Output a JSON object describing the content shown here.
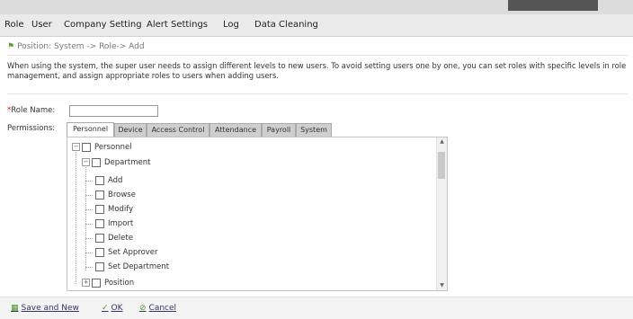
{
  "nav": {
    "items": [
      "Role",
      "User",
      "Company Setting",
      "Alert Settings",
      "Log",
      "Data Cleaning"
    ]
  },
  "breadcrumb": "Position: System -> Role-> Add",
  "description": "When using the system, the super user needs to assign different levels to new users. To avoid setting users one by one, you can set roles with specific levels in role management, and assign appropriate roles to users when adding users.",
  "form": {
    "required_mark": "*",
    "role_name_label": "Role Name:",
    "role_name_value": "",
    "permissions_label": "Permissions:"
  },
  "tabs": [
    "Personnel",
    "Device",
    "Access Control",
    "Attendance",
    "Payroll",
    "System"
  ],
  "active_tab": "Personnel",
  "tree": {
    "root": "Personnel",
    "department": "Department",
    "department_children": [
      "Add",
      "Browse",
      "Modify",
      "Import",
      "Delete",
      "Set Approver",
      "Set Department"
    ],
    "position": "Position"
  },
  "footer": {
    "save_new": "Save and New",
    "ok": "OK",
    "cancel": "Cancel"
  },
  "colors": {
    "nav_bg": "#ebebeb",
    "flag": "#5a9e2f",
    "ok_icon": "#4a9a2a",
    "required": "#dd0000"
  },
  "icons": {
    "breadcrumb": "flag-icon",
    "save_new": "save-icon",
    "ok": "checkmark-icon",
    "cancel": "cancel-icon"
  }
}
